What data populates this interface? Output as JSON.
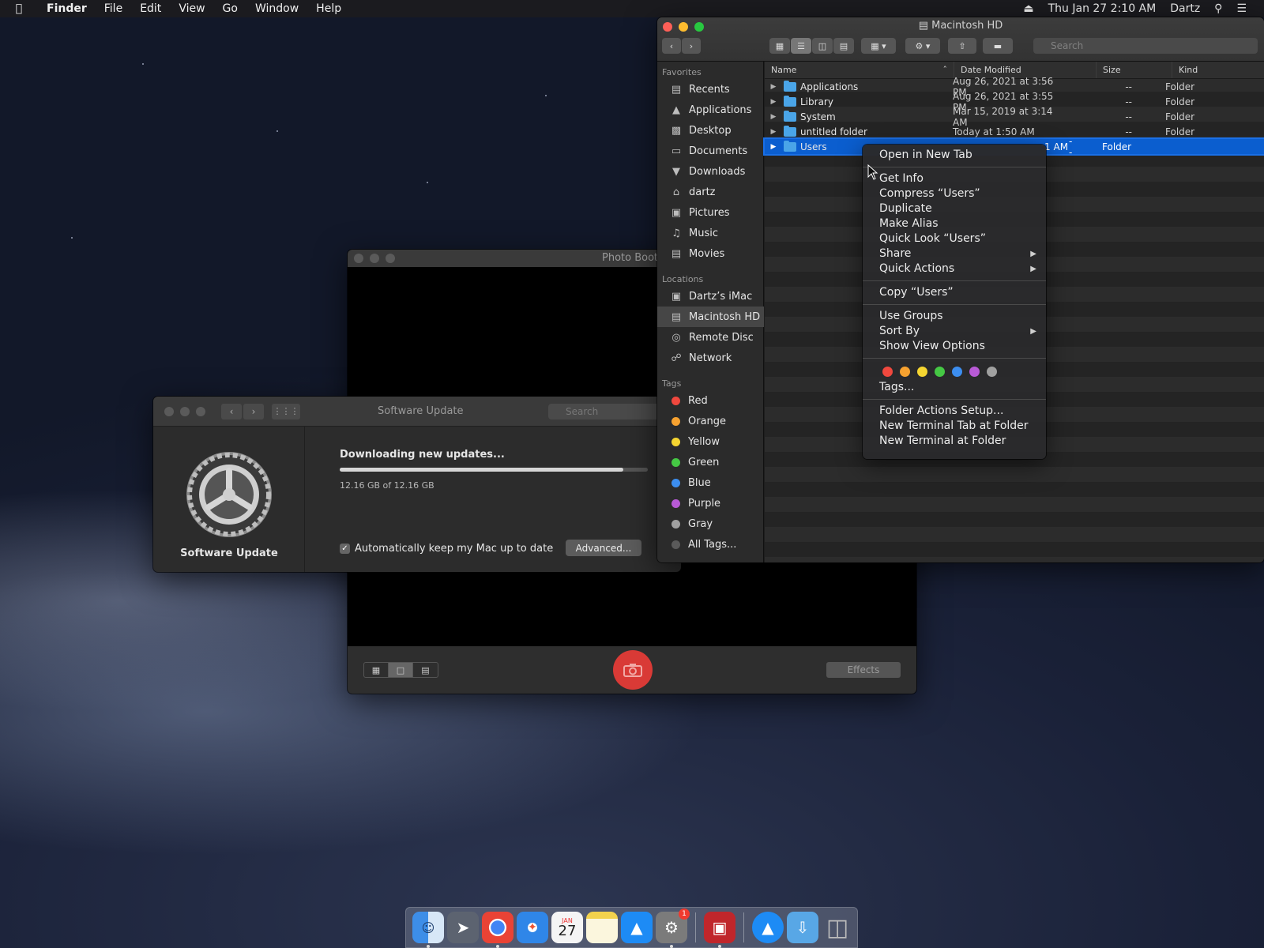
{
  "menubar": {
    "apple": "",
    "app_name": "Finder",
    "items": [
      "File",
      "Edit",
      "View",
      "Go",
      "Window",
      "Help"
    ],
    "clock": "Thu Jan 27  2:10 AM",
    "user": "Dartz"
  },
  "photo_booth": {
    "title": "Photo Booth",
    "effects_label": "Effects"
  },
  "software_update": {
    "title": "Software Update",
    "search_placeholder": "Search",
    "pane_label": "Software Update",
    "status": "Downloading new updates...",
    "progress": 0.92,
    "size_text": "12.16 GB of 12.16 GB",
    "auto_update_label": "Automatically keep my Mac up to date",
    "auto_update_checked": true,
    "advanced_label": "Advanced..."
  },
  "finder": {
    "title": "Macintosh HD",
    "search_placeholder": "Search",
    "sidebar": {
      "favorites_header": "Favorites",
      "favorites": [
        {
          "label": "Recents",
          "icon": "recents-icon"
        },
        {
          "label": "Applications",
          "icon": "applications-icon"
        },
        {
          "label": "Desktop",
          "icon": "desktop-icon"
        },
        {
          "label": "Documents",
          "icon": "documents-icon"
        },
        {
          "label": "Downloads",
          "icon": "downloads-icon"
        },
        {
          "label": "dartz",
          "icon": "home-icon"
        },
        {
          "label": "Pictures",
          "icon": "pictures-icon"
        },
        {
          "label": "Music",
          "icon": "music-icon"
        },
        {
          "label": "Movies",
          "icon": "movies-icon"
        }
      ],
      "locations_header": "Locations",
      "locations": [
        {
          "label": "Dartz’s iMac",
          "icon": "imac-icon"
        },
        {
          "label": "Macintosh HD",
          "icon": "disk-icon",
          "selected": true
        },
        {
          "label": "Remote Disc",
          "icon": "disc-icon"
        },
        {
          "label": "Network",
          "icon": "network-icon"
        }
      ],
      "tags_header": "Tags",
      "tags": [
        {
          "label": "Red",
          "color": "#f0483e"
        },
        {
          "label": "Orange",
          "color": "#f7a230"
        },
        {
          "label": "Yellow",
          "color": "#f5d531"
        },
        {
          "label": "Green",
          "color": "#45c844"
        },
        {
          "label": "Blue",
          "color": "#3c8ef0"
        },
        {
          "label": "Purple",
          "color": "#b85ad6"
        },
        {
          "label": "Gray",
          "color": "#a0a0a0"
        },
        {
          "label": "All Tags...",
          "color": "#5a5a5a"
        }
      ]
    },
    "columns": {
      "name": "Name",
      "date": "Date Modified",
      "size": "Size",
      "kind": "Kind"
    },
    "rows": [
      {
        "name": "Applications",
        "date": "Aug 26, 2021 at 3:56 PM",
        "size": "--",
        "kind": "Folder"
      },
      {
        "name": "Library",
        "date": "Aug 26, 2021 at 3:55 PM",
        "size": "--",
        "kind": "Folder"
      },
      {
        "name": "System",
        "date": "Mar 15, 2019 at 3:14 AM",
        "size": "--",
        "kind": "Folder"
      },
      {
        "name": "untitled folder",
        "date": "Today at 1:50 AM",
        "size": "--",
        "kind": "Folder"
      },
      {
        "name": "Users",
        "date": ":1 AM",
        "size": "--",
        "kind": "Folder",
        "selected": true
      }
    ]
  },
  "context_menu": {
    "groups": [
      [
        "Open in New Tab"
      ],
      [
        "Get Info",
        "Compress “Users”",
        "Duplicate",
        "Make Alias",
        "Quick Look “Users”",
        "Share",
        "Quick Actions"
      ],
      [
        "Copy “Users”"
      ],
      [
        "Use Groups",
        "Sort By",
        "Show View Options"
      ]
    ],
    "submenu_items": [
      "Share",
      "Quick Actions",
      "Sort By"
    ],
    "tag_colors": [
      "#f0483e",
      "#f7a230",
      "#f5d531",
      "#45c844",
      "#3c8ef0",
      "#b85ad6",
      "#a0a0a0"
    ],
    "tags_label": "Tags...",
    "footer": [
      "Folder Actions Setup...",
      "New Terminal Tab at Folder",
      "New Terminal at Folder"
    ]
  },
  "dock": {
    "calendar_month": "JAN",
    "calendar_day": "27",
    "badge_count": "1",
    "apps": [
      {
        "name": "finder-icon",
        "color": "#3d8ee8"
      },
      {
        "name": "launchpad-icon",
        "color": "#6b7280"
      },
      {
        "name": "chrome-icon",
        "color": "#e9e9e9"
      },
      {
        "name": "safari-icon",
        "color": "#2f86e8"
      },
      {
        "name": "calendar-icon",
        "color": "#f5f5f5"
      },
      {
        "name": "notes-icon",
        "color": "#f6e6a0"
      },
      {
        "name": "app-store-icon",
        "color": "#1d8bf5"
      },
      {
        "name": "system-preferences-icon",
        "color": "#7b7b7b"
      },
      {
        "name": "photo-booth-icon",
        "color": "#c0262b"
      },
      {
        "name": "app-store-folder-icon",
        "color": "#1d8bf5"
      },
      {
        "name": "downloads-folder-icon",
        "color": "#58a7e6"
      },
      {
        "name": "trash-icon",
        "color": "#8e8e8e"
      }
    ]
  }
}
